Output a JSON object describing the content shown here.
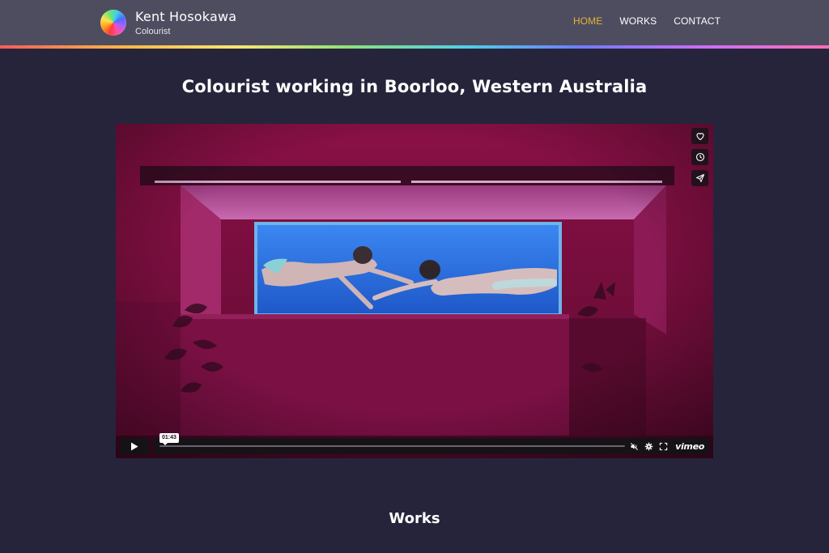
{
  "header": {
    "brand_name": "Kent Hosokawa",
    "brand_tagline": "Colourist",
    "nav": [
      {
        "label": "HOME",
        "active": true
      },
      {
        "label": "WORKS",
        "active": false
      },
      {
        "label": "CONTACT",
        "active": false
      }
    ],
    "active_color": "#e3b533"
  },
  "hero": {
    "title": "Colourist working in Boorloo, Western Australia"
  },
  "video": {
    "timestamp": "01:43",
    "progress": 0.0,
    "side_actions": [
      "heart-icon",
      "clock-icon",
      "paper-plane-icon"
    ],
    "controls": [
      "play-icon",
      "volume-muted-icon",
      "gear-icon",
      "fullscreen-icon"
    ],
    "provider_logo": "vimeo"
  },
  "works": {
    "heading": "Works"
  },
  "colors": {
    "background": "#26243a",
    "header": "#4e4d5f",
    "scene_magenta": "#7a0f3d",
    "water_blue": "#2c6fe0"
  }
}
